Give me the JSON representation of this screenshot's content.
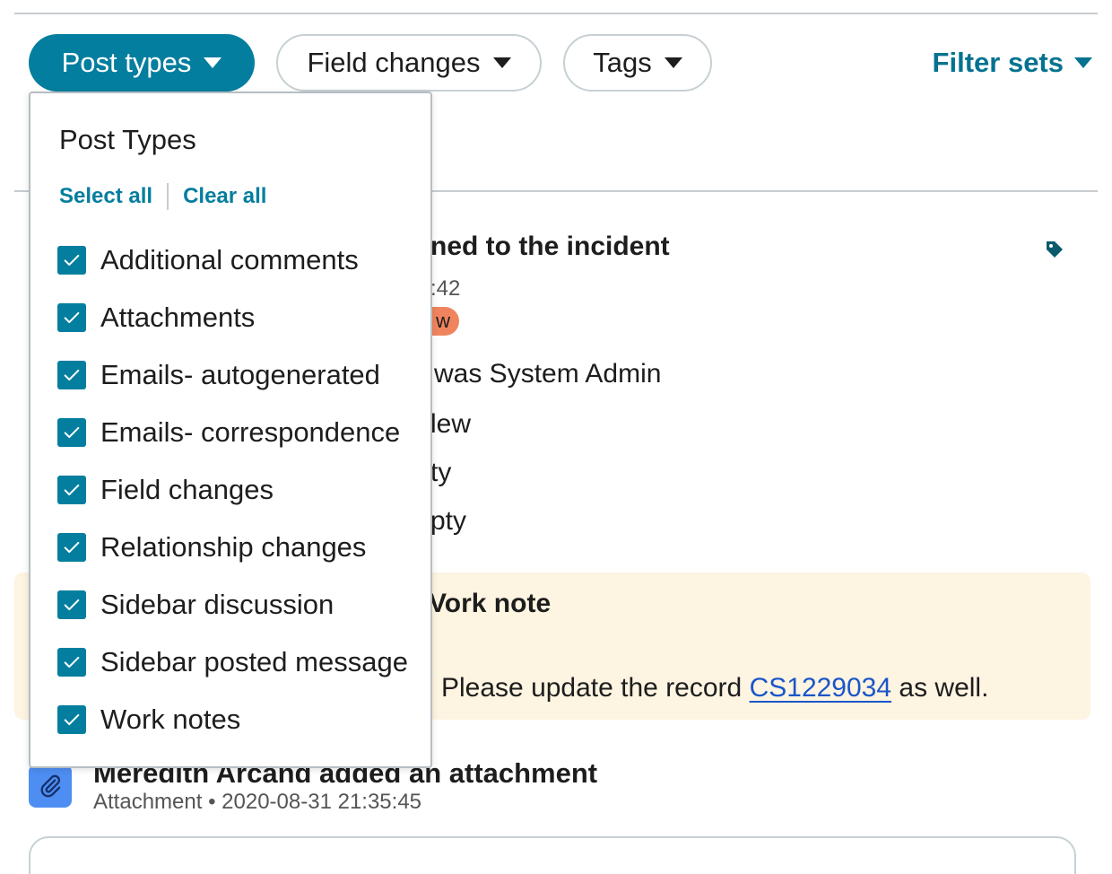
{
  "filters": {
    "post_types": "Post types",
    "field_changes": "Field changes",
    "tags": "Tags",
    "filter_sets": "Filter sets"
  },
  "dropdown": {
    "title": "Post Types",
    "select_all": "Select all",
    "clear_all": "Clear all",
    "options": [
      {
        "label": "Additional comments",
        "checked": true
      },
      {
        "label": "Attachments",
        "checked": true
      },
      {
        "label": "Emails- autogenerated",
        "checked": true
      },
      {
        "label": "Emails- correspondence",
        "checked": true
      },
      {
        "label": "Field changes",
        "checked": true
      },
      {
        "label": "Relationship changes",
        "checked": true
      },
      {
        "label": "Sidebar discussion",
        "checked": true
      },
      {
        "label": "Sidebar posted message",
        "checked": true
      },
      {
        "label": "Work notes",
        "checked": true
      }
    ]
  },
  "background": {
    "entry_title": "ned to the incident",
    "entry_time": ":42",
    "entry_badge": "w",
    "line1": "was System Admin",
    "line2": "lew",
    "line3": "ty",
    "line4": "pty",
    "worknote_title": "Vork note",
    "worknote_before": "Please update the record ",
    "worknote_link": "CS1229034",
    "worknote_after": " as well.",
    "attachment_title": "Meredith Arcand added an attachment",
    "attachment_type": "Attachment",
    "attachment_time": "2020-08-31 21:35:45"
  },
  "colors": {
    "accent": "#047e9e",
    "worknote_bg": "#fdf4e1",
    "badge": "#f0845e",
    "attachment_icon": "#4e8ef2",
    "link": "#1a56c9"
  }
}
